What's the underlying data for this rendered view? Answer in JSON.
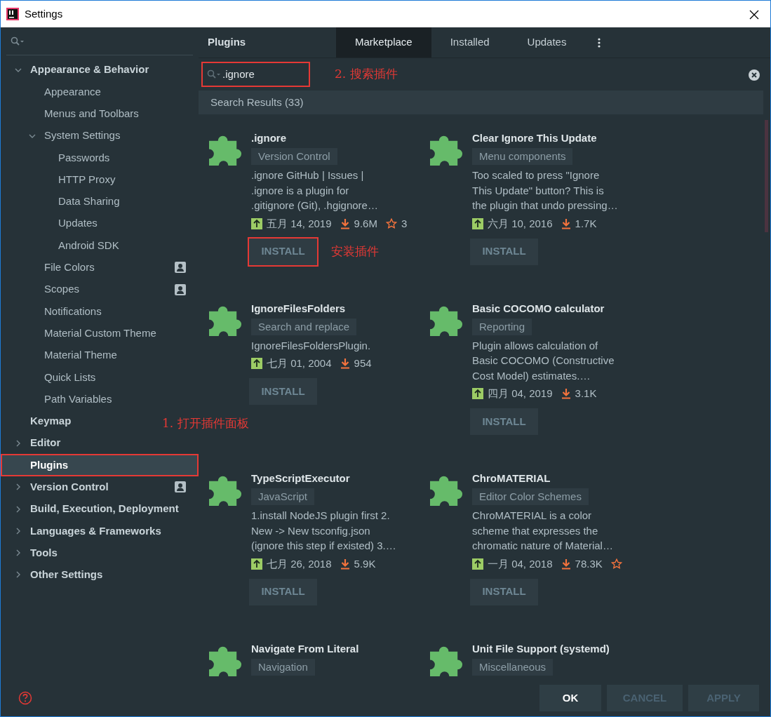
{
  "window": {
    "title": "Settings"
  },
  "sidebar": {
    "note": "1. 打开插件面板",
    "items": [
      {
        "label": "Appearance & Behavior",
        "expanded": true,
        "selected": false,
        "boxed": false,
        "scoped": false,
        "children": [
          {
            "label": "Appearance",
            "selected": false,
            "boxed": false,
            "scoped": false
          },
          {
            "label": "Menus and Toolbars",
            "selected": false,
            "boxed": false,
            "scoped": false
          },
          {
            "label": "System Settings",
            "expanded": true,
            "selected": false,
            "boxed": false,
            "scoped": false,
            "children": [
              {
                "label": "Passwords",
                "selected": false,
                "boxed": false,
                "scoped": false
              },
              {
                "label": "HTTP Proxy",
                "selected": false,
                "boxed": false,
                "scoped": false
              },
              {
                "label": "Data Sharing",
                "selected": false,
                "boxed": false,
                "scoped": false
              },
              {
                "label": "Updates",
                "selected": false,
                "boxed": false,
                "scoped": false
              },
              {
                "label": "Android SDK",
                "selected": false,
                "boxed": false,
                "scoped": false
              }
            ]
          },
          {
            "label": "File Colors",
            "selected": false,
            "boxed": false,
            "scoped": true
          },
          {
            "label": "Scopes",
            "selected": false,
            "boxed": false,
            "scoped": true
          },
          {
            "label": "Notifications",
            "selected": false,
            "boxed": false,
            "scoped": false
          },
          {
            "label": "Material Custom Theme",
            "selected": false,
            "boxed": false,
            "scoped": false
          },
          {
            "label": "Material Theme",
            "selected": false,
            "boxed": false,
            "scoped": false
          },
          {
            "label": "Quick Lists",
            "selected": false,
            "boxed": false,
            "scoped": false
          },
          {
            "label": "Path Variables",
            "selected": false,
            "boxed": false,
            "scoped": false
          }
        ]
      },
      {
        "label": "Keymap",
        "selected": false,
        "boxed": false,
        "scoped": false
      },
      {
        "label": "Editor",
        "expanded": false,
        "selected": false,
        "boxed": false,
        "scoped": false
      },
      {
        "label": "Plugins",
        "selected": true,
        "boxed": true,
        "scoped": false
      },
      {
        "label": "Version Control",
        "expanded": false,
        "selected": false,
        "boxed": false,
        "scoped": true
      },
      {
        "label": "Build, Execution, Deployment",
        "expanded": false,
        "selected": false,
        "boxed": false,
        "scoped": false
      },
      {
        "label": "Languages & Frameworks",
        "expanded": false,
        "selected": false,
        "boxed": false,
        "scoped": false
      },
      {
        "label": "Tools",
        "expanded": false,
        "selected": false,
        "boxed": false,
        "scoped": false
      },
      {
        "label": "Other Settings",
        "expanded": false,
        "selected": false,
        "boxed": false,
        "scoped": false
      }
    ]
  },
  "header": {
    "title": "Plugins",
    "tabs": [
      {
        "label": "Marketplace",
        "selected": true
      },
      {
        "label": "Installed",
        "selected": false
      },
      {
        "label": "Updates",
        "selected": false
      }
    ]
  },
  "search": {
    "value": ".ignore",
    "boxed": true,
    "note": "2. 搜索插件"
  },
  "results_header": "Search Results (33)",
  "plugins": [
    {
      "name": ".ignore",
      "category": "Version Control",
      "description_lines": [
        ".ignore GitHub | Issues |",
        ".ignore is a plugin for",
        ".gitignore (Git), .hgignore…"
      ],
      "date": "五月 14, 2019",
      "downloads": "9.6M",
      "rated": true,
      "rating": "3",
      "install": "INSTALL",
      "install_boxed": true,
      "note": "安装插件"
    },
    {
      "name": "Clear Ignore This Update",
      "category": "Menu components",
      "description_lines": [
        "Too scaled to press \"Ignore",
        "This Update\" button? This is",
        "the plugin that undo pressing…"
      ],
      "date": "六月 10, 2016",
      "downloads": "1.7K",
      "rated": false,
      "install": "INSTALL",
      "install_boxed": false
    },
    {
      "name": "IgnoreFilesFolders",
      "category": "Search and replace",
      "description_lines": [
        "IgnoreFilesFoldersPlugin."
      ],
      "date": "七月 01, 2004",
      "downloads": "954",
      "rated": false,
      "install": "INSTALL",
      "install_boxed": false
    },
    {
      "name": "Basic COCOMO calculator",
      "category": "Reporting",
      "description_lines": [
        "Plugin allows calculation of",
        "Basic COCOMO (Constructive",
        "Cost Model) estimates.…"
      ],
      "date": "四月 04, 2019",
      "downloads": "3.1K",
      "rated": false,
      "install": "INSTALL",
      "install_boxed": false
    },
    {
      "name": "TypeScriptExecutor",
      "category": "JavaScript",
      "description_lines": [
        "1.install NodeJS plugin first 2.",
        "New -> New tsconfig.json",
        "(ignore this step if existed) 3.…"
      ],
      "date": "七月 26, 2018",
      "downloads": "5.9K",
      "rated": false,
      "install": "INSTALL",
      "install_boxed": false
    },
    {
      "name": "ChroMATERIAL",
      "category": "Editor Color Schemes",
      "description_lines": [
        "ChroMATERIAL is a color",
        "scheme that expresses the",
        "chromatic nature of Material…"
      ],
      "date": "一月 04, 2018",
      "downloads": "78.3K",
      "rated": true,
      "install": "INSTALL",
      "install_boxed": false
    },
    {
      "name": "Navigate From Literal",
      "category": "Navigation"
    },
    {
      "name": "Unit File Support (systemd)",
      "category": "Miscellaneous"
    }
  ],
  "buttons": [
    {
      "label": "OK",
      "disabled": false
    },
    {
      "label": "CANCEL",
      "disabled": true
    },
    {
      "label": "APPLY",
      "disabled": true
    }
  ]
}
